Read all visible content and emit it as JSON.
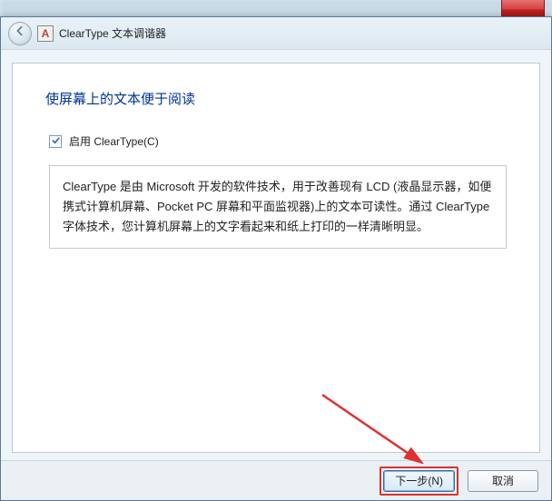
{
  "titlebar": {
    "app_icon_letter": "A",
    "title": "ClearType 文本调谐器"
  },
  "content": {
    "heading": "使屏幕上的文本便于阅读",
    "checkbox": {
      "checked": true,
      "label": "启用 ClearType(C)"
    },
    "description": "ClearType 是由 Microsoft 开发的软件技术，用于改善现有 LCD (液晶显示器，如便携式计算机屏幕、Pocket PC 屏幕和平面监视器)上的文本可读性。通过 ClearType 字体技术，您计算机屏幕上的文字看起来和纸上打印的一样清晰明显。"
  },
  "footer": {
    "next_label": "下一步(N)",
    "cancel_label": "取消"
  }
}
